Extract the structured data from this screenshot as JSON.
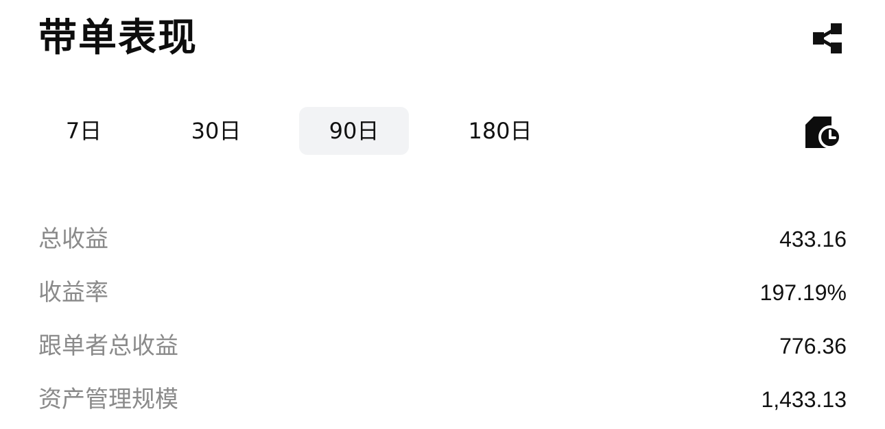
{
  "header": {
    "title": "带单表现",
    "share_icon": "share-icon"
  },
  "tabs": [
    {
      "label": "7日",
      "active": false
    },
    {
      "label": "30日",
      "active": false
    },
    {
      "label": "90日",
      "active": true
    },
    {
      "label": "180日",
      "active": false
    }
  ],
  "history_icon": "document-clock-icon",
  "stats": [
    {
      "label": "总收益",
      "value": "433.16"
    },
    {
      "label": "收益率",
      "value": "197.19%"
    },
    {
      "label": "跟单者总收益",
      "value": "776.36"
    },
    {
      "label": "资产管理规模",
      "value": "1,433.13"
    }
  ],
  "colors": {
    "text_primary": "#111111",
    "text_secondary": "#8a8a8a",
    "tab_active_bg": "#f2f3f5",
    "background": "#ffffff"
  }
}
